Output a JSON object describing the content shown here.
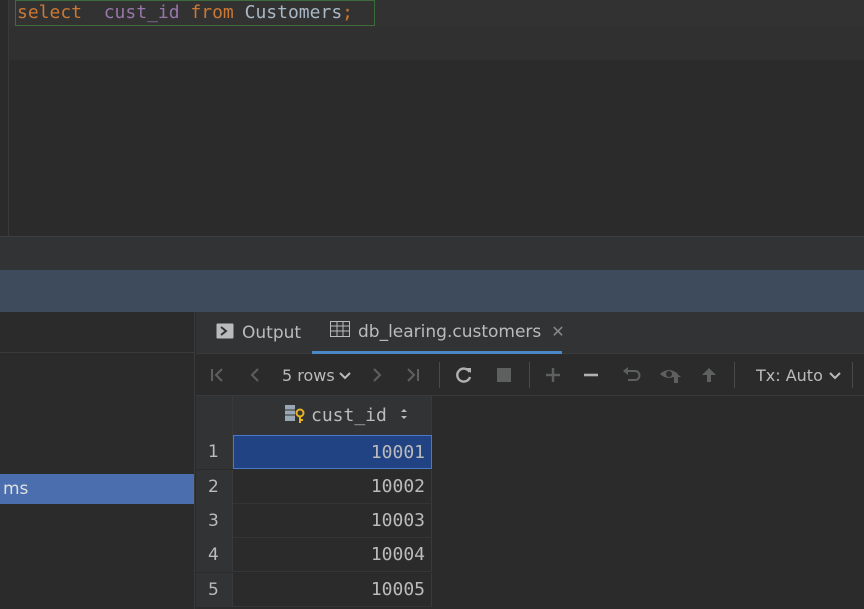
{
  "editor": {
    "code": {
      "kw1": "select",
      "col": "cust_id",
      "kw2": "from",
      "table": "Customers",
      "semi": ";"
    }
  },
  "left_panel": {
    "selected_item": "ms"
  },
  "tabs": [
    {
      "label": "Output",
      "icon": "console-icon"
    },
    {
      "label": "db_learing.customers",
      "icon": "table-icon",
      "active": true
    }
  ],
  "toolbar": {
    "rows_label": "5 rows",
    "tx_label": "Tx: Auto"
  },
  "grid": {
    "columns": [
      "cust_id"
    ],
    "rows": [
      {
        "n": "1",
        "cust_id": "10001",
        "selected": true
      },
      {
        "n": "2",
        "cust_id": "10002"
      },
      {
        "n": "3",
        "cust_id": "10003"
      },
      {
        "n": "4",
        "cust_id": "10004"
      },
      {
        "n": "5",
        "cust_id": "10005"
      }
    ]
  },
  "colors": {
    "accent": "#4b6eaf",
    "selection": "#214283",
    "background": "#2b2b2b"
  }
}
